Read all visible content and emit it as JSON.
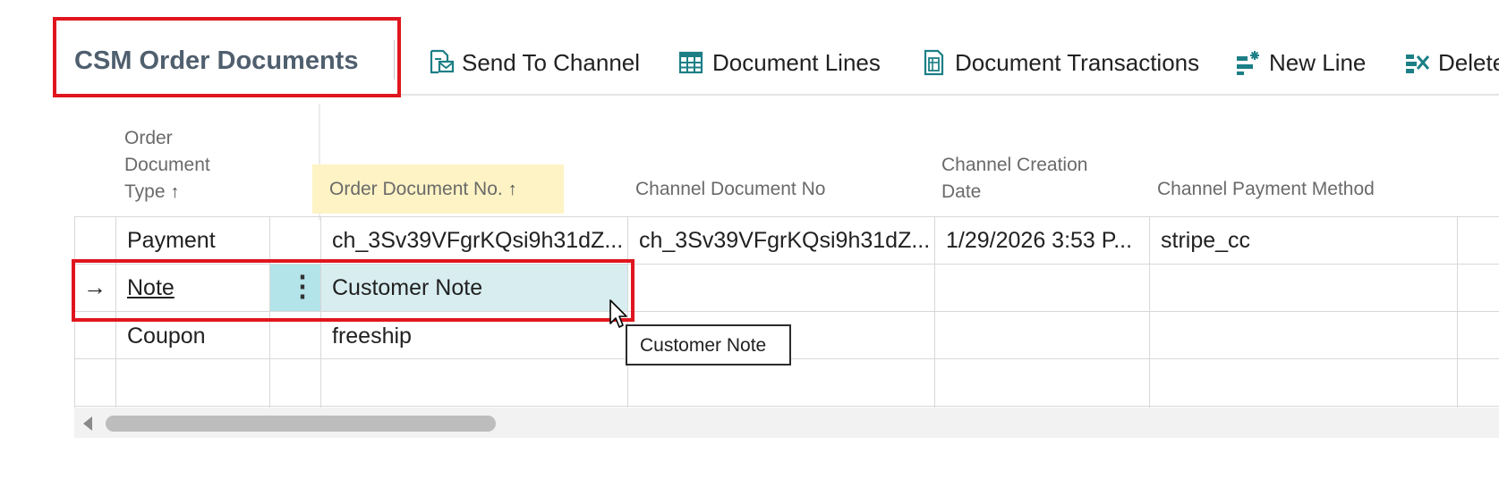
{
  "page": {
    "title": "CSM Order Documents"
  },
  "toolbar": {
    "send_to_channel": "Send To Channel",
    "document_lines": "Document Lines",
    "document_transactions": "Document Transactions",
    "new_line": "New Line",
    "delete": "Delete"
  },
  "columns": {
    "order_document_type": "Order Document Type",
    "order_document_type_lines": [
      "Order",
      "Document",
      "Type"
    ],
    "order_document_no": "Order Document No.",
    "channel_document_no": "Channel Document No",
    "channel_creation_date_lines": [
      "Channel Creation",
      "Date"
    ],
    "channel_payment_method": "Channel Payment Method",
    "sort_arrow": "↑"
  },
  "rows": [
    {
      "type": "Payment",
      "order_document_no": "ch_3Sv39VFgrKQsi9h31dZ...",
      "channel_document_no": "ch_3Sv39VFgrKQsi9h31dZ...",
      "channel_creation_date": "1/29/2026 3:53 P...",
      "channel_payment_method": "stripe_cc"
    },
    {
      "type": "Note",
      "order_document_no": "Customer Note",
      "channel_document_no": "",
      "channel_creation_date": "",
      "channel_payment_method": "",
      "active": true
    },
    {
      "type": "Coupon",
      "order_document_no": "freeship",
      "channel_document_no": "",
      "channel_creation_date": "",
      "channel_payment_method": ""
    }
  ],
  "tooltip": {
    "text": "Customer Note"
  },
  "row_indicator": "→",
  "row_menu_glyph": "⋮",
  "colors": {
    "accent_teal": "#1c7f86",
    "highlight_red": "#e0161f",
    "sort_header_bg": "#fdf3c4",
    "active_cell_bg": "#d8edf0"
  }
}
